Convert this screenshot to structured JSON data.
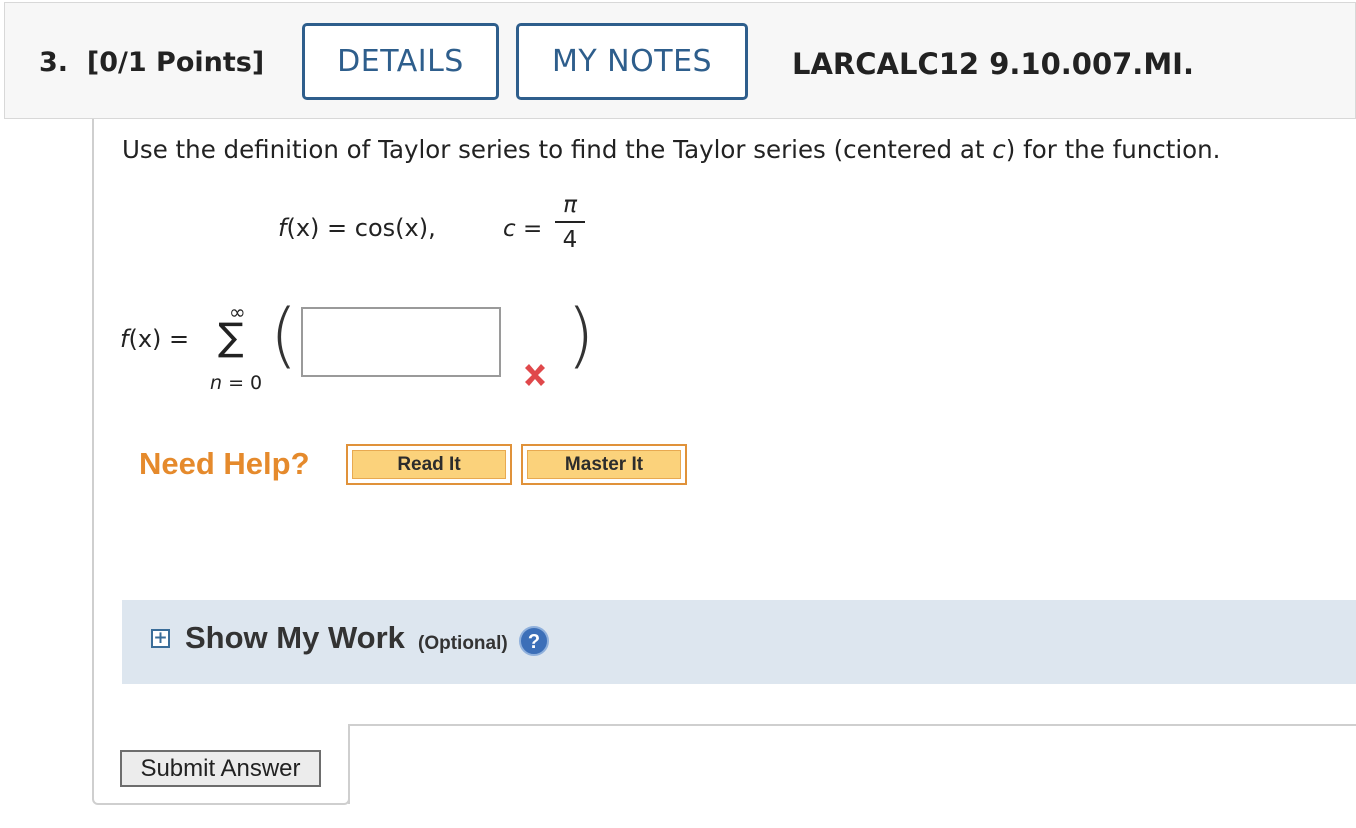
{
  "header": {
    "question_number": "3.",
    "points": "[0/1 Points]",
    "details_label": "DETAILS",
    "notes_label": "MY NOTES",
    "problem_code": "LARCALC12 9.10.007.MI."
  },
  "question": {
    "text_before": "Use the definition of Taylor series to find the Taylor series (centered at ",
    "c_var": "c",
    "text_after": ") for the function."
  },
  "equation": {
    "f_var": "f",
    "f_rhs": "(x) = cos(x),",
    "c_eq": "c =",
    "numerator": "π",
    "denominator": "4"
  },
  "series": {
    "lhs_f": "f",
    "lhs_rest": "(x) =",
    "sigma": "∑",
    "upper_limit": "∞",
    "lower_limit_var": "n",
    "lower_limit_rest": " = 0",
    "left_paren": "(",
    "right_paren": ")",
    "answer_value": "",
    "answer_status": "incorrect"
  },
  "help": {
    "label": "Need Help?",
    "read_it": "Read It",
    "master_it": "Master It"
  },
  "work": {
    "expand_symbol": "+",
    "title": "Show My Work",
    "optional": "(Optional)",
    "help_symbol": "?"
  },
  "submit_label": "Submit Answer",
  "colors": {
    "accent_blue": "#2e5e8c",
    "help_orange": "#e58a2c",
    "button_fill": "#fbd27b",
    "error_red": "#e0484b",
    "work_bg": "#dde6ef"
  }
}
